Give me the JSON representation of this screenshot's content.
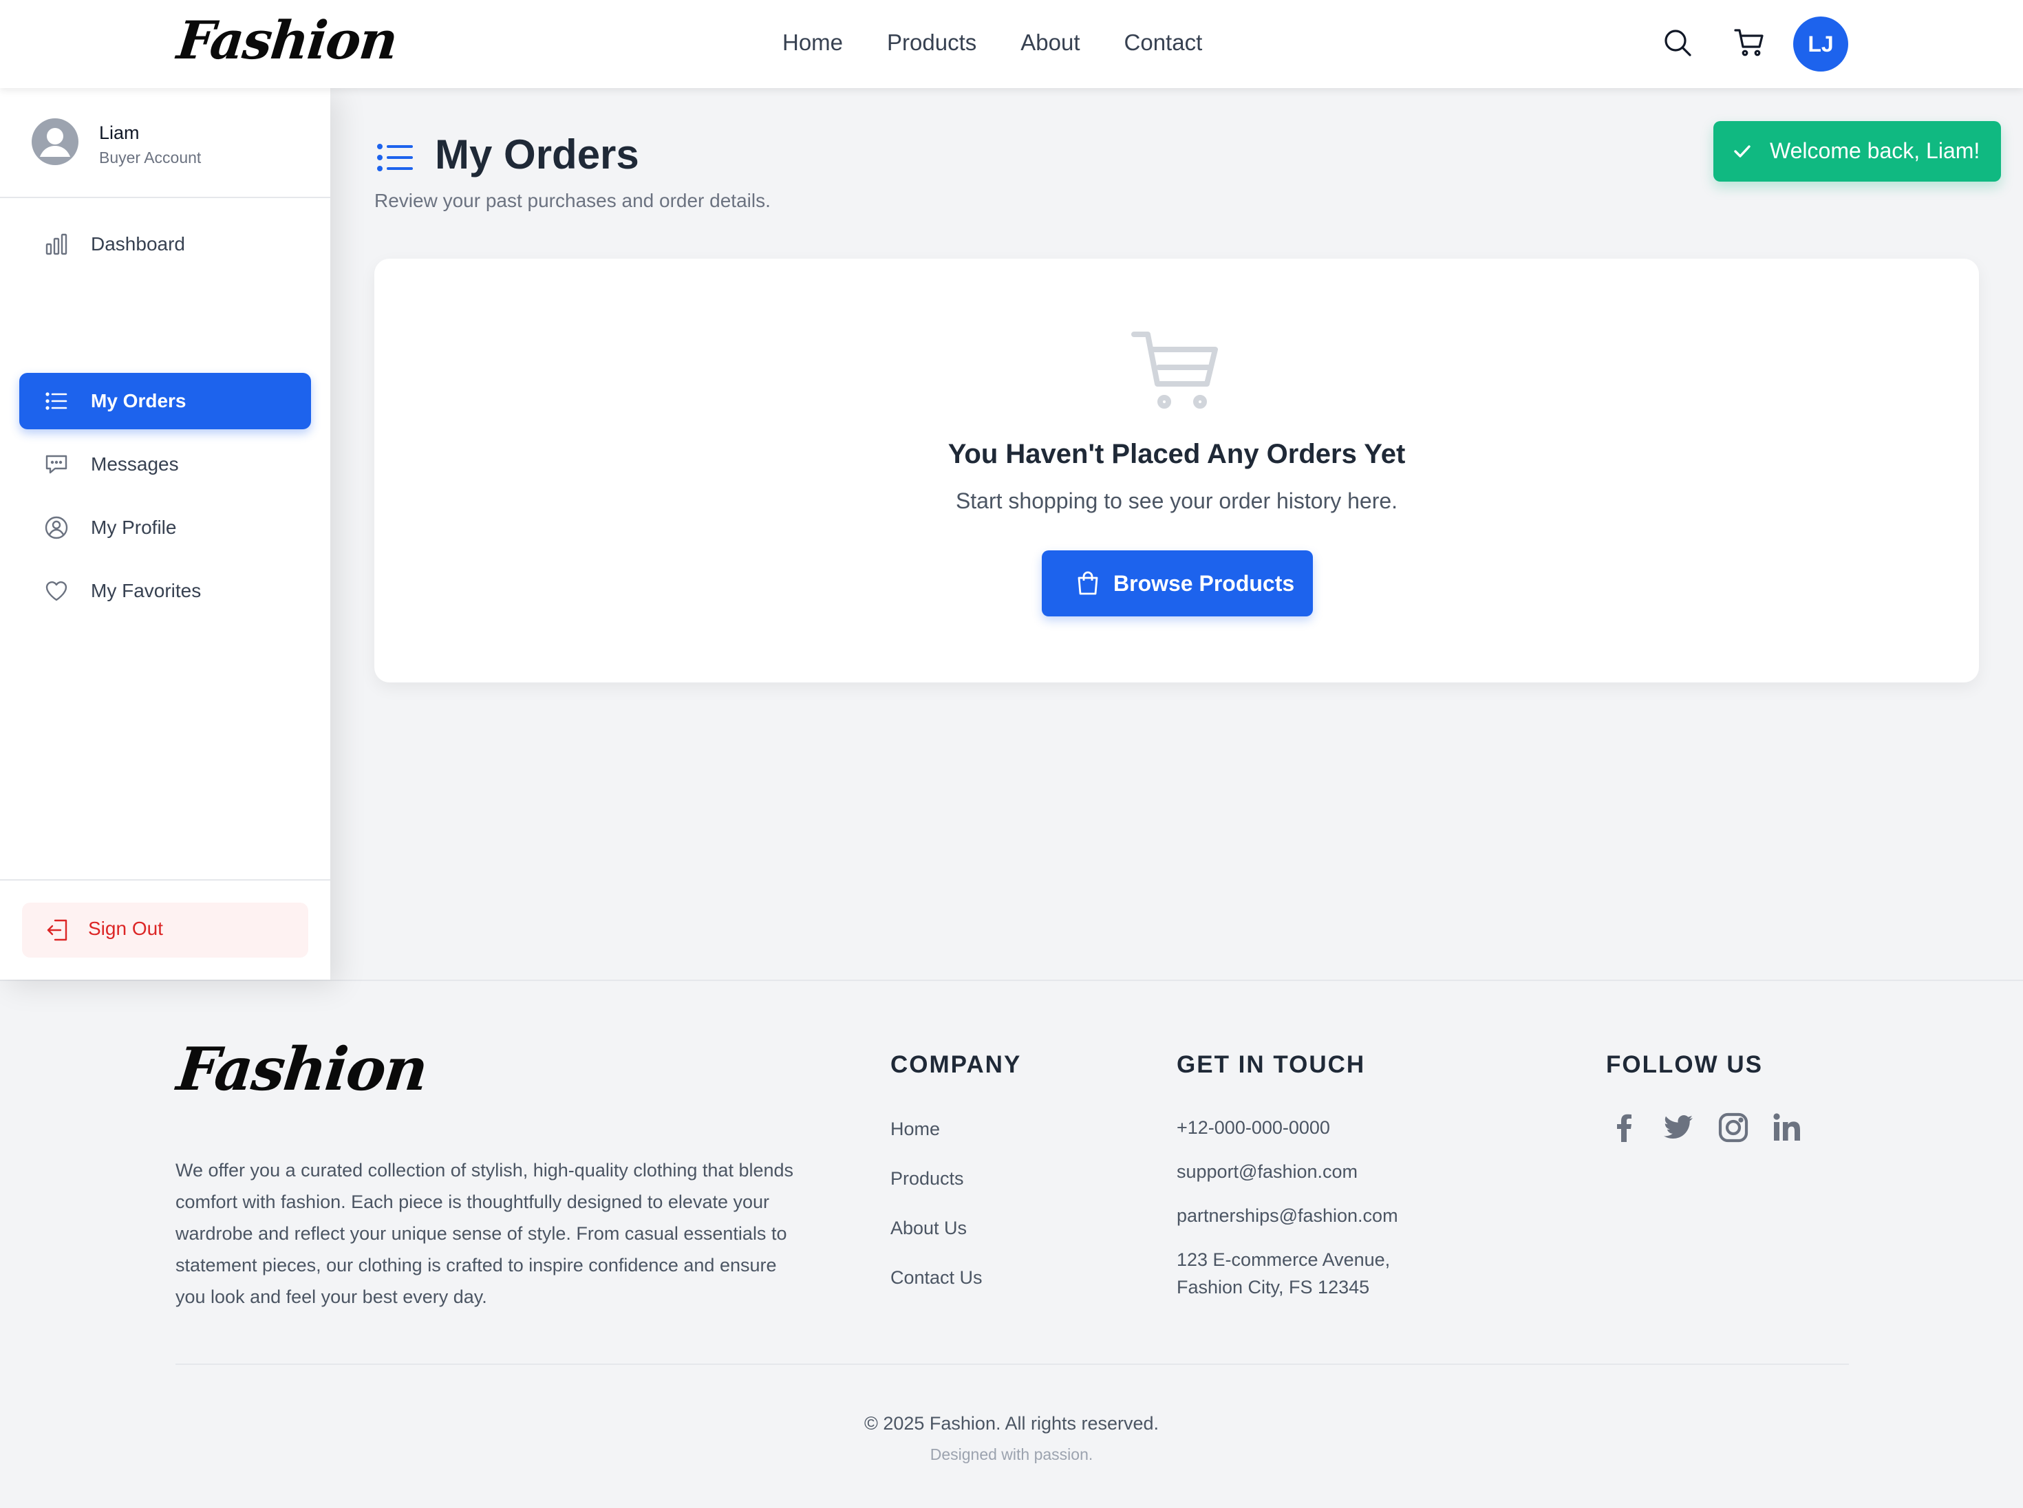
{
  "brand": {
    "logo_text": "Fashion"
  },
  "nav": {
    "items": [
      {
        "label": "Home"
      },
      {
        "label": "Products"
      },
      {
        "label": "About"
      },
      {
        "label": "Contact"
      }
    ]
  },
  "header": {
    "search_icon": "search-icon",
    "cart_icon": "cart-icon",
    "user_initials": "LJ"
  },
  "sidebar": {
    "user_name": "Liam",
    "user_role": "Buyer Account",
    "items": [
      {
        "label": "Dashboard",
        "icon": "chart-bar-icon"
      },
      {
        "label": "My Orders",
        "icon": "list-icon",
        "active": true
      },
      {
        "label": "Messages",
        "icon": "chat-icon"
      },
      {
        "label": "My Profile",
        "icon": "user-circle-icon"
      },
      {
        "label": "My Favorites",
        "icon": "heart-icon"
      }
    ],
    "sign_out": "Sign Out"
  },
  "main": {
    "title": "My Orders",
    "subtitle": "Review your past purchases and order details.",
    "empty_title": "You Haven't Placed Any Orders Yet",
    "empty_text": "Start shopping to see your order history here.",
    "browse_button": "Browse Products"
  },
  "toast": {
    "message": "Welcome back, Liam!"
  },
  "footer": {
    "logo_text": "Fashion",
    "about": "We offer you a curated collection of stylish, high-quality clothing that blends comfort with fashion. Each piece is thoughtfully designed to elevate your wardrobe and reflect your unique sense of style. From casual essentials to statement pieces, our clothing is crafted to inspire confidence and ensure you look and feel your best every day.",
    "company_heading": "COMPANY",
    "company_links": [
      "Home",
      "Products",
      "About Us",
      "Contact Us"
    ],
    "touch_heading": "GET IN TOUCH",
    "phone": "+12-000-000-0000",
    "email_support": "support@fashion.com",
    "email_partner": "partnerships@fashion.com",
    "address_line1": "123 E-commerce Avenue,",
    "address_line2": "Fashion City, FS 12345",
    "follow_heading": "FOLLOW US",
    "social": [
      "facebook-icon",
      "twitter-icon",
      "instagram-icon",
      "linkedin-icon"
    ],
    "copyright": "© 2025 Fashion. All rights reserved.",
    "designed": "Designed with passion."
  },
  "colors": {
    "primary": "#1d63ed",
    "success": "#10b981",
    "danger": "#dc2626",
    "background": "#f3f4f6"
  }
}
